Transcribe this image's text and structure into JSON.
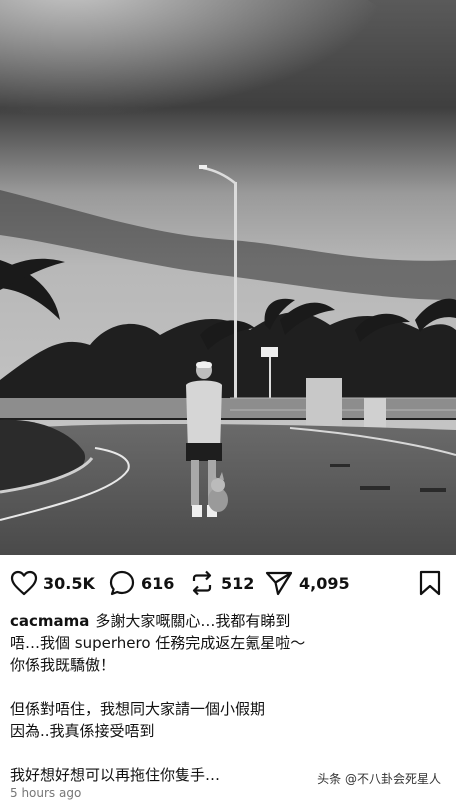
{
  "post": {
    "photo_description": "",
    "actions": {
      "likes": "30.5K",
      "comments": "616",
      "reposts": "512",
      "shares": "4,095"
    },
    "caption": {
      "username": "cacmama",
      "lines": [
        "多謝大家嘅關心…我都有睇到",
        "唔…我個 superhero 任務完成返左氪星啦～",
        "你係我既驕傲！",
        "",
        "但係對唔住，我想同大家請一個小假期",
        "因為..我真係接受唔到",
        "",
        "我好想好想可以再拖住你隻手…"
      ]
    },
    "time_ago": "5 hours ago"
  },
  "watermark": "头条 @不八卦会死星人"
}
